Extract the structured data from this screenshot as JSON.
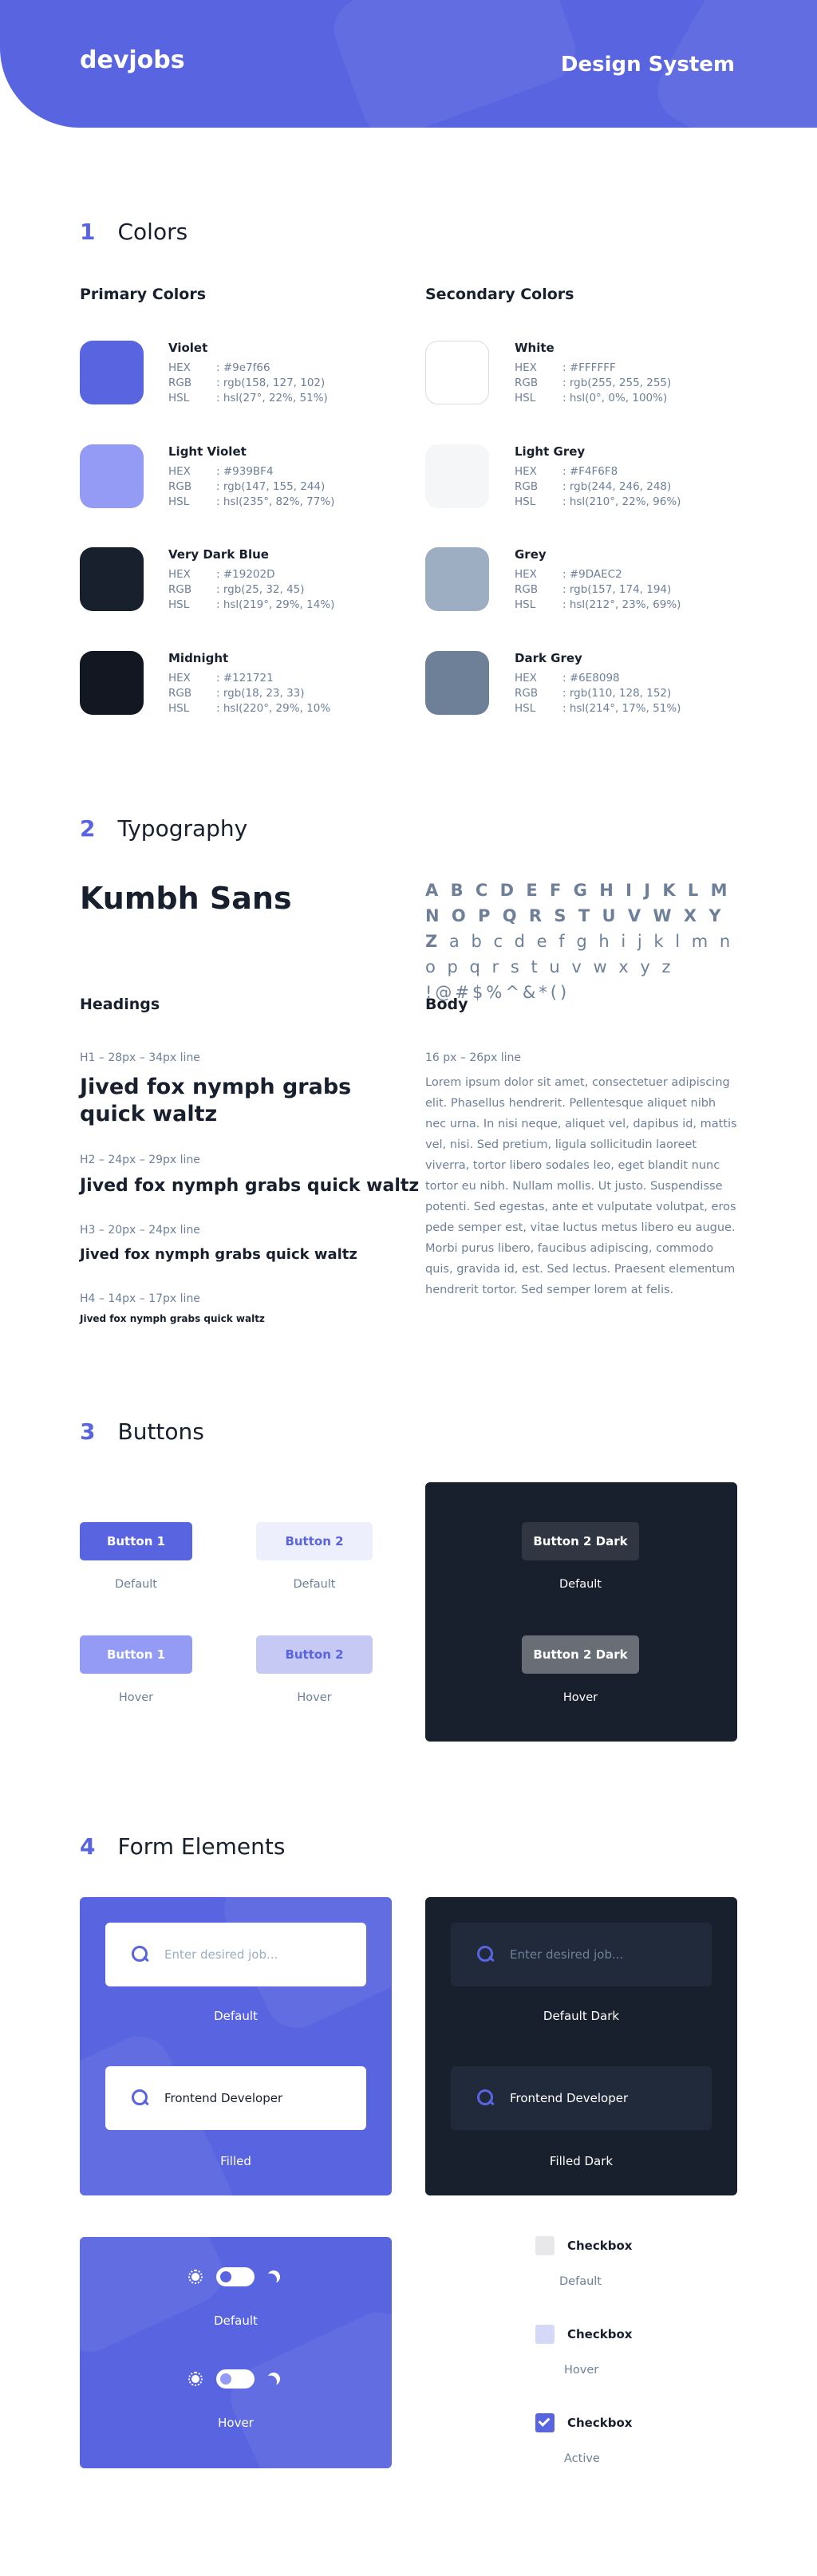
{
  "header": {
    "logo": "devjobs",
    "title": "Design System"
  },
  "colors": {
    "section_number": "1",
    "section_title": "Colors",
    "primary_title": "Primary Colors",
    "secondary_title": "Secondary Colors",
    "primary": [
      {
        "name": "Violet",
        "hex": ": #9e7f66",
        "rgb": ": rgb(158, 127, 102)",
        "hsl": ": hsl(27°, 22%, 51%)",
        "swatch": "#5964E0"
      },
      {
        "name": "Light Violet",
        "hex": ": #939BF4",
        "rgb": ": rgb(147, 155, 244)",
        "hsl": ": hsl(235°, 82%, 77%)",
        "swatch": "#939BF4"
      },
      {
        "name": "Very Dark Blue",
        "hex": ": #19202D",
        "rgb": ": rgb(25, 32, 45)",
        "hsl": ": hsl(219°, 29%, 14%)",
        "swatch": "#19202D"
      },
      {
        "name": "Midnight",
        "hex": ": #121721",
        "rgb": ": rgb(18, 23, 33)",
        "hsl": ": hsl(220°, 29%, 10%",
        "swatch": "#121721"
      }
    ],
    "secondary": [
      {
        "name": "White",
        "hex": ": #FFFFFF",
        "rgb": ": rgb(255, 255, 255)",
        "hsl": ": hsl(0°, 0%, 100%)",
        "swatch": "#FFFFFF"
      },
      {
        "name": "Light Grey",
        "hex": ": #F4F6F8",
        "rgb": ": rgb(244, 246, 248)",
        "hsl": ": hsl(210°, 22%, 96%)",
        "swatch": "#F4F6F8"
      },
      {
        "name": "Grey",
        "hex": ": #9DAEC2",
        "rgb": ": rgb(157, 174, 194)",
        "hsl": ": hsl(212°, 23%, 69%)",
        "swatch": "#9DAEC2"
      },
      {
        "name": "Dark Grey",
        "hex": ": #6E8098",
        "rgb": ": rgb(110, 128, 152)",
        "hsl": ": hsl(214°, 17%, 51%)",
        "swatch": "#6E8098"
      }
    ],
    "labels": {
      "hex": "HEX",
      "rgb": "RGB",
      "hsl": "HSL"
    }
  },
  "typography": {
    "section_number": "2",
    "section_title": "Typography",
    "font_name": "Kumbh Sans",
    "alphabet_upper": "A B C D E F G H I J K L M N O P Q R S T U V W X Y Z",
    "alphabet_lower": " a b c d e f g h i j k l m n o p q r s t u v w x y z !@#$%^&*()",
    "headings_title": "Headings",
    "body_title": "Body",
    "h1_spec": "H1 – 28px – 34px line",
    "h2_spec": "H2 – 24px – 29px line",
    "h3_spec": "H3 – 20px – 24px line",
    "h4_spec": "H4 – 14px – 17px line",
    "sample": "Jived fox nymph grabs quick waltz",
    "body_spec": "16 px – 26px line",
    "body_text": "Lorem ipsum dolor sit amet, consectetuer adipiscing elit. Phasellus hendrerit. Pellentesque aliquet nibh nec urna. In nisi neque, aliquet vel, dapibus id, mattis vel, nisi. Sed pretium, ligula sollicitudin laoreet viverra, tortor libero sodales leo, eget blandit nunc tortor eu nibh. Nullam mollis. Ut justo. Suspendisse potenti. Sed egestas, ante et vulputate volutpat, eros pede semper est, vitae luctus metus libero eu augue. Morbi purus libero, faucibus adipiscing, commodo quis, gravida id, est. Sed lectus. Praesent elementum hendrerit tortor. Sed semper lorem at felis."
  },
  "buttons": {
    "section_number": "3",
    "section_title": "Buttons",
    "button1": "Button 1",
    "button2": "Button 2",
    "button2_dark": "Button 2 Dark",
    "default": "Default",
    "hover": "Hover"
  },
  "forms": {
    "section_number": "4",
    "section_title": "Form Elements",
    "search_placeholder": "Enter desired job...",
    "search_value": "Frontend Developer",
    "default": "Default",
    "filled": "Filled",
    "default_dark": "Default Dark",
    "filled_dark": "Filled Dark",
    "toggle_default": "Default",
    "toggle_hover": "Hover",
    "checkbox_label": "Checkbox",
    "checkbox_states": [
      "Default",
      "Hover",
      "Active"
    ]
  }
}
